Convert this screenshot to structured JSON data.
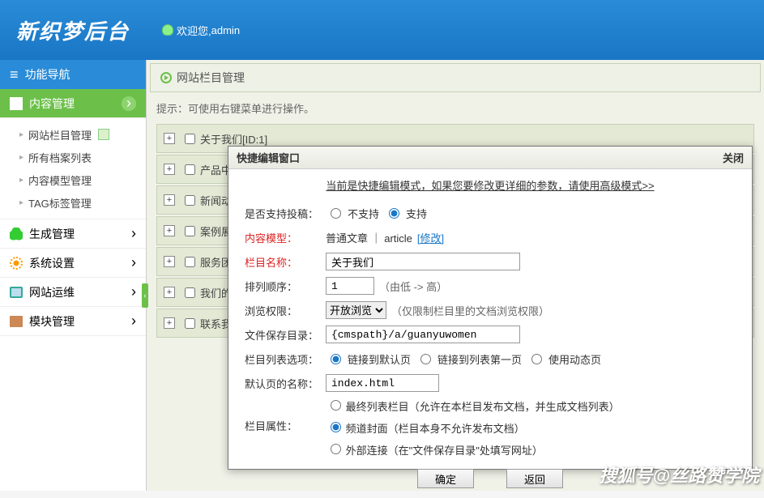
{
  "header": {
    "logo": "新织梦后台",
    "welcome_prefix": "欢迎您,",
    "username": "admin"
  },
  "sidebar": {
    "nav_header": "功能导航",
    "groups": [
      {
        "label": "内容管理",
        "active": true,
        "icon": "doc",
        "items": [
          {
            "label": "网站栏目管理",
            "marked": true
          },
          {
            "label": "所有档案列表"
          },
          {
            "label": "内容模型管理"
          },
          {
            "label": "TAG标签管理"
          }
        ]
      },
      {
        "label": "生成管理",
        "icon": "tree"
      },
      {
        "label": "系统设置",
        "icon": "gear"
      },
      {
        "label": "网站运维",
        "icon": "monitor"
      },
      {
        "label": "模块管理",
        "icon": "brick"
      }
    ]
  },
  "page": {
    "title": "网站栏目管理",
    "hint": "提示：可使用右键菜单进行操作。",
    "rows": [
      {
        "label": "关于我们[ID:1]"
      },
      {
        "label": "产品中"
      },
      {
        "label": "新闻动"
      },
      {
        "label": "案例展"
      },
      {
        "label": "服务团"
      },
      {
        "label": "我们的"
      },
      {
        "label": "联系我"
      }
    ]
  },
  "modal": {
    "title": "快捷编辑窗口",
    "close": "关闭",
    "tip_text": "当前是快捷编辑模式，如果您要修改更详细的参数，请使用高级模式>>",
    "form": {
      "submit_support": {
        "label": "是否支持投稿：",
        "opt_no": "不支持",
        "opt_yes": "支持"
      },
      "content_model": {
        "label": "内容模型：",
        "value": "普通文章 ｜ article",
        "change": "[修改]"
      },
      "name": {
        "label": "栏目名称：",
        "value": "关于我们"
      },
      "sort": {
        "label": "排列顺序：",
        "value": "1",
        "hint": "（由低 -> 高）"
      },
      "perm": {
        "label": "浏览权限：",
        "selected": "开放浏览",
        "hint": "（仅限制栏目里的文档浏览权限）"
      },
      "save_path": {
        "label": "文件保存目录：",
        "value": "{cmspath}/a/guanyuwomen"
      },
      "list_opt": {
        "label": "栏目列表选项：",
        "opt1": "链接到默认页",
        "opt2": "链接到列表第一页",
        "opt3": "使用动态页"
      },
      "default_page": {
        "label": "默认页的名称：",
        "value": "index.html"
      },
      "attr": {
        "label": "栏目属性：",
        "opt1": "最终列表栏目（允许在本栏目发布文档，并生成文档列表）",
        "opt2": "频道封面（栏目本身不允许发布文档）",
        "opt3": "外部连接（在\"文件保存目录\"处填写网址）"
      }
    },
    "buttons": {
      "ok": "确定",
      "back": "返回"
    }
  },
  "watermark": "搜狐号@丝路赞学院"
}
